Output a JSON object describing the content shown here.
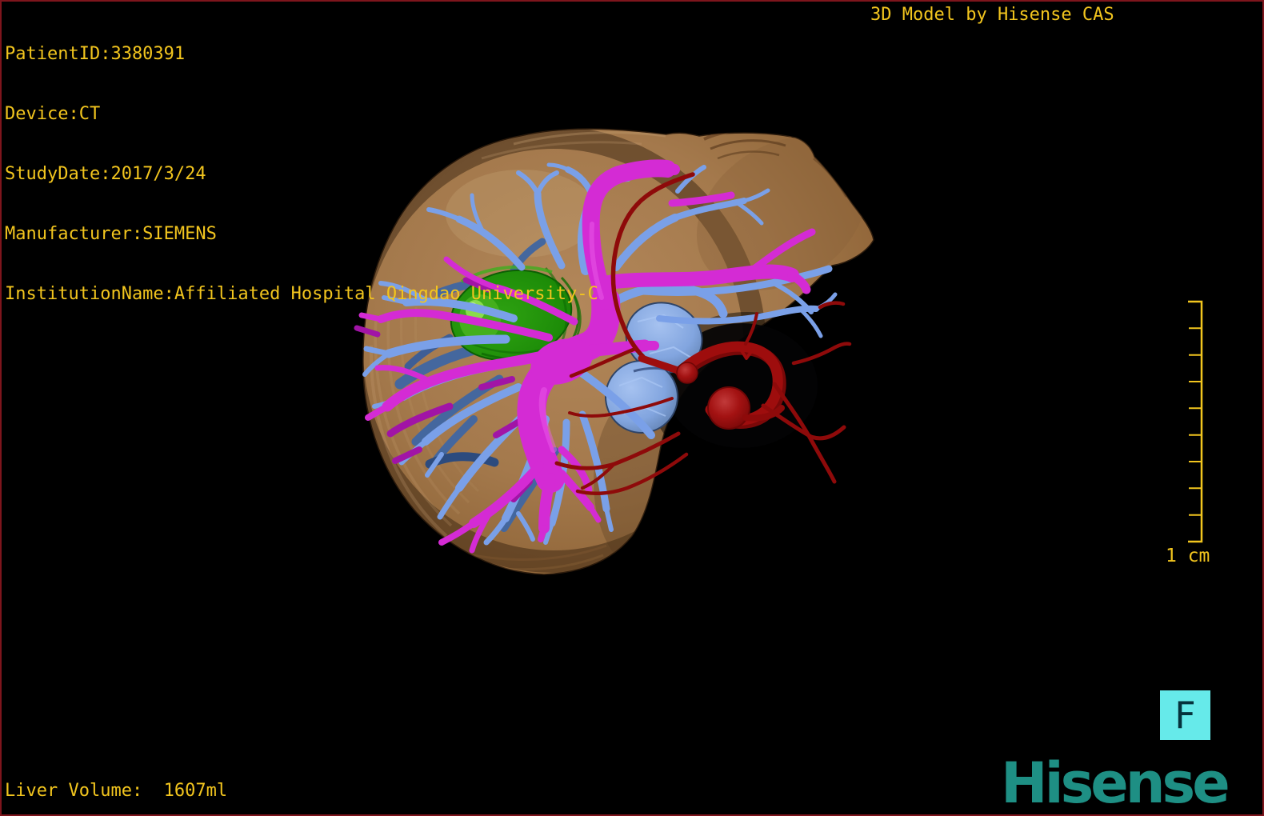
{
  "frame": {
    "border_color": "#7E151C",
    "background": "#000000"
  },
  "overlay": {
    "text_color": "#F2C51E",
    "patient_info": [
      "PatientID:3380391",
      "Device:CT",
      "StudyDate:2017/3/24",
      "Manufacturer:SIEMENS",
      "InstitutionName:Affiliated Hospital Qingdao University-C"
    ],
    "watermark": "3D Model by Hisense CAS",
    "liver_volume": "Liver Volume:  1607ml"
  },
  "scale_bar": {
    "label": "1 cm",
    "tick_intervals": 9,
    "color": "#F2C51E"
  },
  "orientation_marker": {
    "label": "F",
    "box_color": "#66EAEA",
    "text_color": "#05323C"
  },
  "brand": {
    "logo_text": "Hisense",
    "color": "#1E8F84"
  },
  "model": {
    "structures": [
      {
        "name": "liver-surface",
        "color": "#A87C4E"
      },
      {
        "name": "portal-vein",
        "color": "#D42BD4"
      },
      {
        "name": "hepatic-vein",
        "color": "#7AA0E8"
      },
      {
        "name": "hepatic-artery",
        "color": "#9E0D0D"
      },
      {
        "name": "tumor",
        "color": "#219409"
      },
      {
        "name": "gallbladder",
        "color": "#82A5DF"
      }
    ]
  }
}
